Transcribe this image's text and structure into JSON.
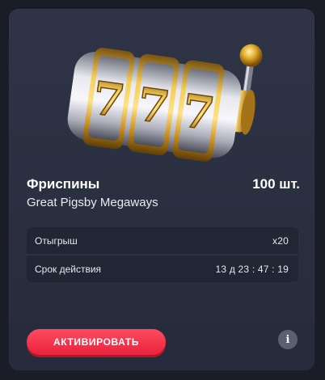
{
  "card": {
    "title": "Фриспины",
    "count": "100 шт.",
    "game": "Great Pigsby Megaways",
    "details": [
      {
        "label": "Отыгрыш",
        "value": "x20"
      },
      {
        "label": "Срок действия",
        "value": "13 д 23 : 47 : 19"
      }
    ],
    "activate_label": "АКТИВИРОВАТЬ",
    "info_label": "i"
  },
  "colors": {
    "accent": "#f0314a",
    "gold": "#d9a21b",
    "card_bg": "#2b3042"
  },
  "icons": {
    "illustration": "slot-machine-777-icon",
    "info": "info-icon"
  }
}
